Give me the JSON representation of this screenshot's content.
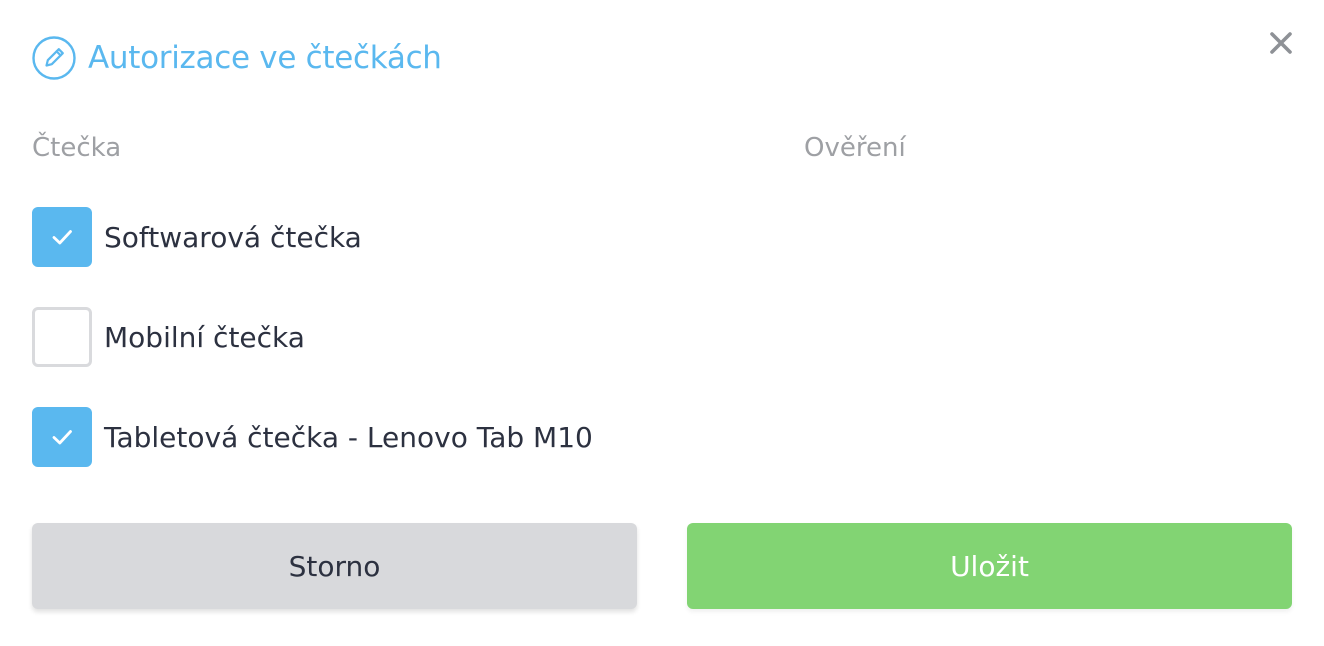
{
  "dialog": {
    "title": "Autorizace ve čtečkách",
    "title_icon": "pencil-circle-icon",
    "close_icon": "close-icon"
  },
  "columns": {
    "reader": "Čtečka",
    "verification": "Ověření"
  },
  "readers": [
    {
      "label": "Softwarová čtečka",
      "checked": true
    },
    {
      "label": "Mobilní čtečka",
      "checked": false
    },
    {
      "label": "Tabletová čtečka - Lenovo Tab M10",
      "checked": true
    }
  ],
  "buttons": {
    "cancel_label": "Storno",
    "save_label": "Uložit"
  },
  "colors": {
    "accent": "#5ab8ef",
    "save": "#82d473",
    "cancel": "#d8d9dc"
  }
}
